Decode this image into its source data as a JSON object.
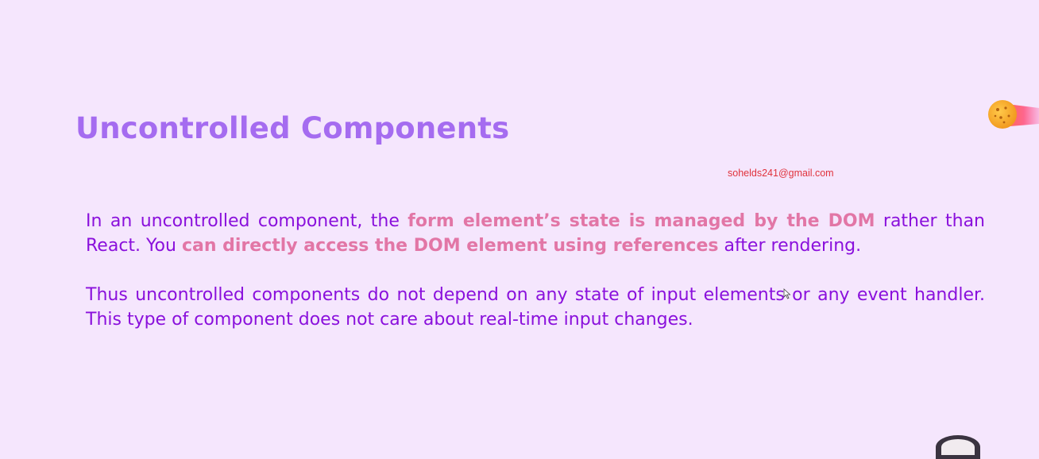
{
  "slide": {
    "title": "Uncontrolled Components",
    "watermark_email": "sohelds241@gmail.com",
    "paragraph1": {
      "p1": "In an uncontrolled component, the ",
      "h1": "form element’s state is managed by the DOM",
      "p2": " rather than React. You ",
      "h2": "can directly access the DOM element using references",
      "p3": " after rendering."
    },
    "paragraph2": "Thus uncontrolled components do not depend on any state of input elements or any event handler. This type of component does not care about real-time input changes."
  },
  "colors": {
    "background": "#f5e6fd",
    "title": "#a56cf0",
    "body_text": "#8a10dc",
    "highlight": "#e276a6",
    "email": "#e0323c"
  },
  "icons": {
    "comet": "comet-icon",
    "cursor": "mouse-cursor-icon",
    "presenter_avatar": "avatar"
  }
}
